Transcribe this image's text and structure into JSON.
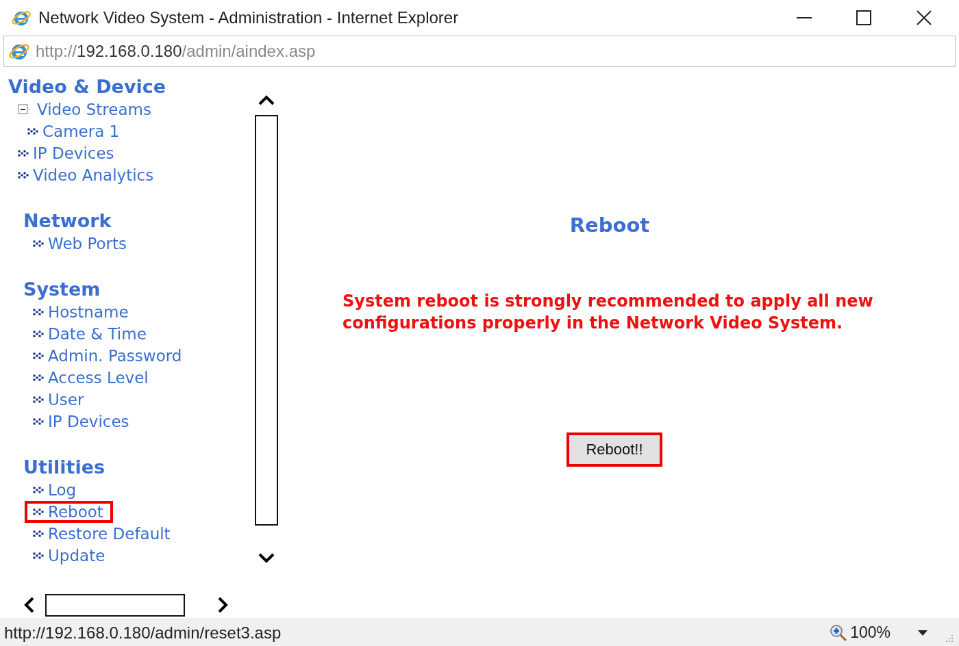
{
  "window": {
    "title": "Network Video System - Administration - Internet Explorer"
  },
  "address_bar": {
    "scheme": "http://",
    "host": "192.168.0.180",
    "path": "/admin/aindex.asp"
  },
  "sidebar": {
    "sections": [
      {
        "heading": "Video & Device",
        "items": [
          {
            "label": "Video Streams",
            "expanded": true,
            "highlighted": false,
            "children": [
              {
                "label": "Camera 1",
                "highlighted": false
              }
            ]
          },
          {
            "label": "IP Devices",
            "highlighted": false
          },
          {
            "label": "Video Analytics",
            "highlighted": false
          }
        ]
      },
      {
        "heading": "Network",
        "items": [
          {
            "label": "Web Ports",
            "highlighted": false
          }
        ]
      },
      {
        "heading": "System",
        "items": [
          {
            "label": "Hostname",
            "highlighted": false
          },
          {
            "label": "Date & Time",
            "highlighted": false
          },
          {
            "label": "Admin. Password",
            "highlighted": false
          },
          {
            "label": "Access Level",
            "highlighted": false
          },
          {
            "label": "User",
            "highlighted": false
          },
          {
            "label": "IP Devices",
            "highlighted": false
          }
        ]
      },
      {
        "heading": "Utilities",
        "items": [
          {
            "label": "Log",
            "highlighted": false
          },
          {
            "label": "Reboot",
            "highlighted": true
          },
          {
            "label": "Restore Default",
            "highlighted": false
          },
          {
            "label": "Update",
            "highlighted": false
          }
        ]
      }
    ]
  },
  "main": {
    "title": "Reboot",
    "message": "System reboot is strongly recommended to apply all new configurations properly in the Network Video System.",
    "button": {
      "label": "Reboot!!",
      "highlighted": true
    }
  },
  "status_bar": {
    "url": "http://192.168.0.180/admin/reset3.asp",
    "zoom": "100%"
  }
}
